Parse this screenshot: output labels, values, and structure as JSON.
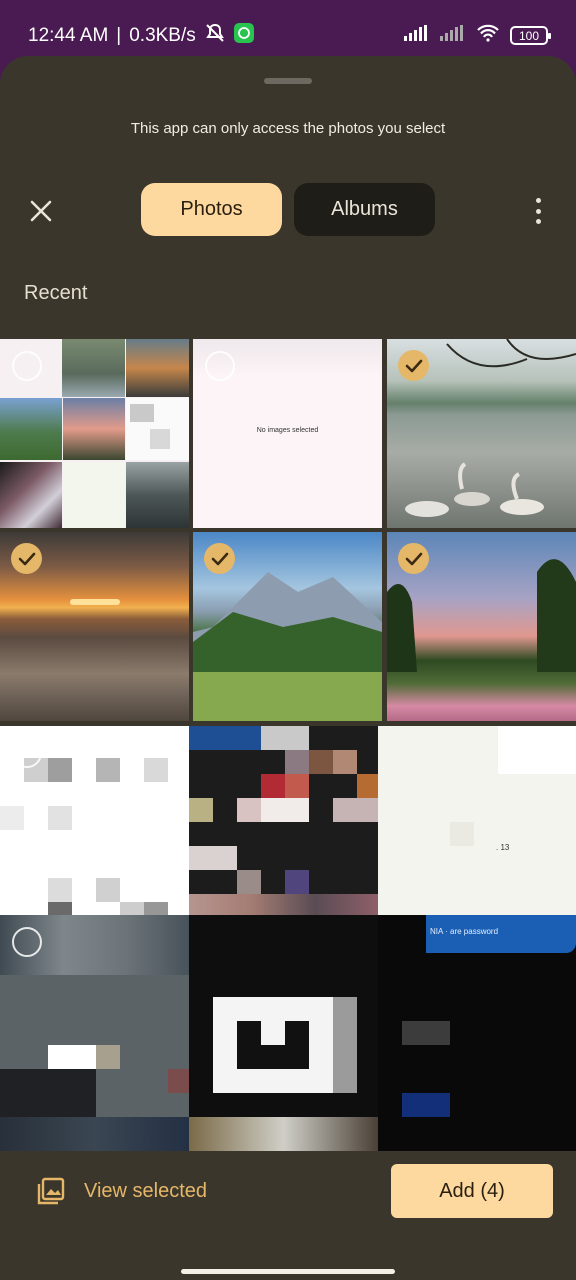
{
  "status": {
    "time": "12:44 AM",
    "speed": "0.3KB/s",
    "battery": "100"
  },
  "picker": {
    "notice": "This app can only access the photos you select",
    "tabs": [
      "Photos",
      "Albums"
    ],
    "section": "Recent",
    "tiles": [
      {
        "kind": "screenshot-collage",
        "selected": false
      },
      {
        "kind": "screenshot",
        "text": "No images selected",
        "selected": false
      },
      {
        "kind": "photo-lake-swans",
        "selected": true
      },
      {
        "kind": "photo-sea-sunset",
        "selected": true
      },
      {
        "kind": "photo-mountain-meadow",
        "selected": true
      },
      {
        "kind": "photo-flowers-sunset",
        "selected": true
      },
      {
        "kind": "pixelated",
        "selected": false
      },
      {
        "kind": "pixelated",
        "selected": false
      },
      {
        "kind": "pixelated",
        "text": ". 13",
        "selected": false
      },
      {
        "kind": "pixelated",
        "selected": false
      },
      {
        "kind": "pixelated",
        "selected": false
      },
      {
        "kind": "pixelated",
        "text": "NIA · are password",
        "selected": false
      }
    ]
  },
  "bottom": {
    "view_selected": "View selected",
    "add": "Add (4)"
  },
  "colors": {
    "accent": "#e5b768",
    "tab_active": "#fdd9a0",
    "sheet": "#3a362c",
    "status_bar": "#4a1b52"
  }
}
